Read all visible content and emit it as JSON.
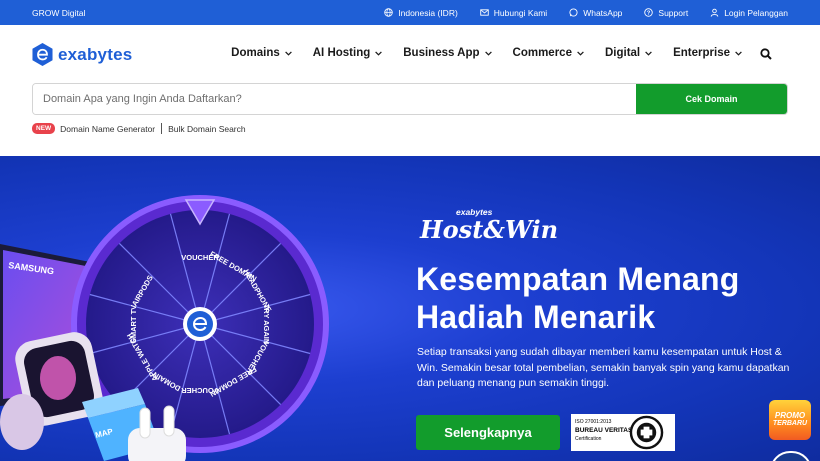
{
  "topbar": {
    "brand": "GROW Digital",
    "links": [
      {
        "label": "Indonesia (IDR)",
        "icon": "globe-icon"
      },
      {
        "label": "Hubungi Kami",
        "icon": "mail-icon"
      },
      {
        "label": "WhatsApp",
        "icon": "whatsapp-icon"
      },
      {
        "label": "Support",
        "icon": "question-icon"
      },
      {
        "label": "Login Pelanggan",
        "icon": "user-icon"
      }
    ]
  },
  "nav": {
    "logo_text": "exabytes",
    "items": [
      {
        "label": "Domains"
      },
      {
        "label": "AI Hosting"
      },
      {
        "label": "Business App"
      },
      {
        "label": "Commerce"
      },
      {
        "label": "Digital"
      },
      {
        "label": "Enterprise"
      }
    ]
  },
  "domain_search": {
    "placeholder": "Domain Apa yang Ingin Anda Daftarkan?",
    "button_label": "Cek Domain"
  },
  "sublinks": {
    "badge": "NEW",
    "generator": "Domain Name Generator",
    "bulk": "Bulk Domain Search"
  },
  "hero": {
    "logo_small": "exabytes",
    "logo_big": "Host&Win",
    "title": "Kesempatan Menang Hadiah Menarik",
    "description": "Setiap transaksi yang sudah dibayar memberi kamu kesempatan untuk Host & Win. Semakin besar total pembelian, semakin banyak spin yang kamu dapatkan dan peluang menang pun semakin tinggi.",
    "cta_label": "Selengkapnya",
    "wheel_labels": [
      "VOUCHER",
      "FREE DOMAIN",
      "HEADPHONE",
      "TRY AGAIN",
      "VOUCHER",
      "FREE DOMAIN",
      "VOUCHER",
      "DOMAIN",
      "APPLE WATCH",
      "SMART TV",
      "AIRPODS"
    ],
    "tv_brand": "SAMSUNG",
    "box_label": "MAP"
  },
  "certification": {
    "line1": "ISO 27001:2013",
    "line2": "BUREAU VERITAS",
    "line3": "Certification"
  },
  "promo": {
    "line1": "PROMO",
    "line2": "TERBARU"
  },
  "colors": {
    "topbar": "#1f5fd6",
    "brand_blue": "#1f5fd6",
    "green": "#129c2c",
    "hero_blue": "#1d3fd0",
    "badge_red": "#e8424b"
  }
}
